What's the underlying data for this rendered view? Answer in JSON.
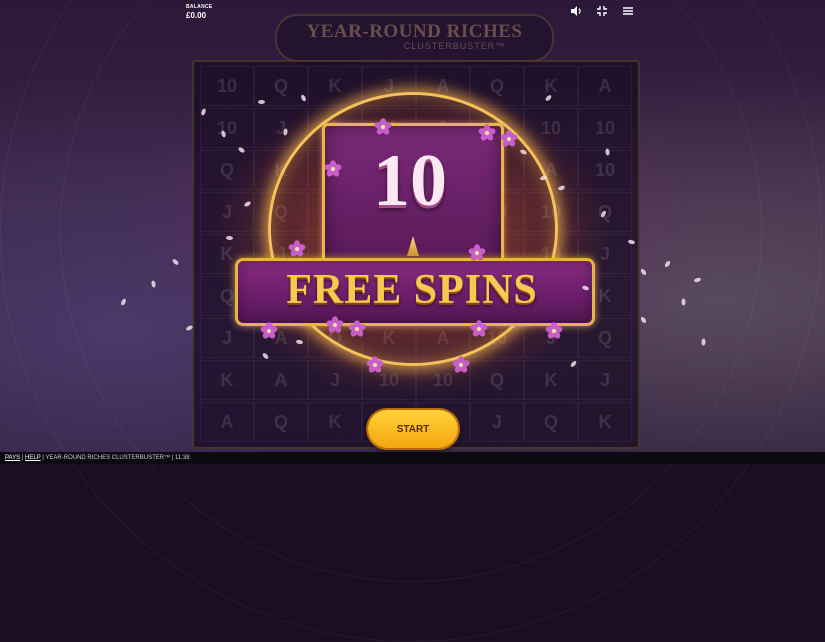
{
  "balance": {
    "label": "BALANCE",
    "value": "£0.00"
  },
  "top_icons": {
    "sound": "speaker-icon",
    "fullscreen": "fullscreen-icon",
    "menu": "hamburger-menu-icon"
  },
  "logo": {
    "title": "YEAR-ROUND RICHES",
    "subtitle": "CLUSTERBUSTER™"
  },
  "reel_symbols": [
    "10",
    "Q",
    "K",
    "J",
    "A",
    "Q",
    "K",
    "A",
    "10",
    "J",
    "Q",
    "K",
    "A",
    "J",
    "10"
  ],
  "award": {
    "count": "10",
    "label": "FREE SPINS"
  },
  "start_button": {
    "label": "START"
  },
  "footer": {
    "pays_link": "PAYS",
    "separator": " | ",
    "help_link": "HELP",
    "game_name": "YEAR-ROUND RICHES CLUSTERBUSTER™",
    "time": "11:38"
  },
  "colors": {
    "gold": "#e8b24a",
    "magenta": "#6c1e6a",
    "button": "#f4a50e",
    "blossom": "#c85ec9"
  }
}
